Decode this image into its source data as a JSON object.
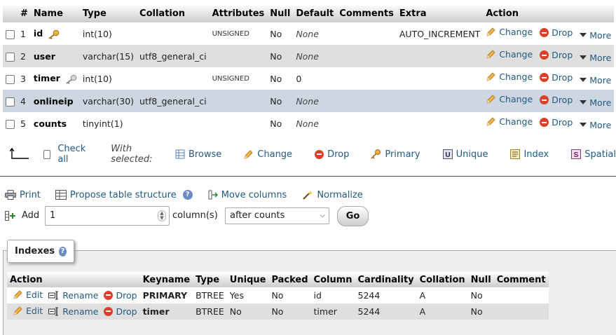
{
  "structure": {
    "headers": [
      "#",
      "Name",
      "Type",
      "Collation",
      "Attributes",
      "Null",
      "Default",
      "Comments",
      "Extra",
      "Action"
    ],
    "rows": [
      {
        "num": "1",
        "name": "id",
        "key_icon": "primary-key-icon",
        "type": "int(10)",
        "collation": "",
        "attributes": "UNSIGNED",
        "null": "No",
        "default": "None",
        "comments": "",
        "extra": "AUTO_INCREMENT"
      },
      {
        "num": "2",
        "name": "user",
        "key_icon": "",
        "type": "varchar(15)",
        "collation": "utf8_general_ci",
        "attributes": "",
        "null": "No",
        "default": "None",
        "comments": "",
        "extra": ""
      },
      {
        "num": "3",
        "name": "timer",
        "key_icon": "index-key-icon",
        "type": "int(10)",
        "collation": "",
        "attributes": "UNSIGNED",
        "null": "No",
        "default": "0",
        "comments": "",
        "extra": ""
      },
      {
        "num": "4",
        "name": "onlineip",
        "key_icon": "",
        "type": "varchar(30)",
        "collation": "utf8_general_ci",
        "attributes": "",
        "null": "No",
        "default": "None",
        "comments": "",
        "extra": ""
      },
      {
        "num": "5",
        "name": "counts",
        "key_icon": "",
        "type": "tinyint(1)",
        "collation": "",
        "attributes": "",
        "null": "No",
        "default": "None",
        "comments": "",
        "extra": ""
      }
    ],
    "row_actions": {
      "change": "Change",
      "drop": "Drop",
      "more": "More"
    }
  },
  "with_selected": {
    "check_all": "Check all",
    "label": "With selected:",
    "browse": "Browse",
    "change": "Change",
    "drop": "Drop",
    "primary": "Primary",
    "unique": "Unique",
    "index": "Index",
    "spatial": "Spatial"
  },
  "tools": {
    "print": "Print",
    "propose": "Propose table structure",
    "move_columns": "Move columns",
    "normalize": "Normalize"
  },
  "add_columns": {
    "label": "Add",
    "value": "1",
    "unit": "column(s)",
    "position": "after counts",
    "go": "Go"
  },
  "indexes": {
    "legend": "Indexes",
    "headers": [
      "Action",
      "Keyname",
      "Type",
      "Unique",
      "Packed",
      "Column",
      "Cardinality",
      "Collation",
      "Null",
      "Comment"
    ],
    "actions": {
      "edit": "Edit",
      "rename": "Rename",
      "drop": "Drop"
    },
    "rows": [
      {
        "keyname": "PRIMARY",
        "type": "BTREE",
        "unique": "Yes",
        "packed": "No",
        "column": "id",
        "cardinality": "5244",
        "collation": "A",
        "null": "No",
        "comment": ""
      },
      {
        "keyname": "timer",
        "type": "BTREE",
        "unique": "No",
        "packed": "No",
        "column": "timer",
        "cardinality": "5244",
        "collation": "A",
        "null": "No",
        "comment": ""
      }
    ]
  },
  "colors": {
    "link": "#235a81",
    "marked_row": "#ced6e2",
    "even_row": "#dfdfdf",
    "drop": "#d9412b"
  }
}
